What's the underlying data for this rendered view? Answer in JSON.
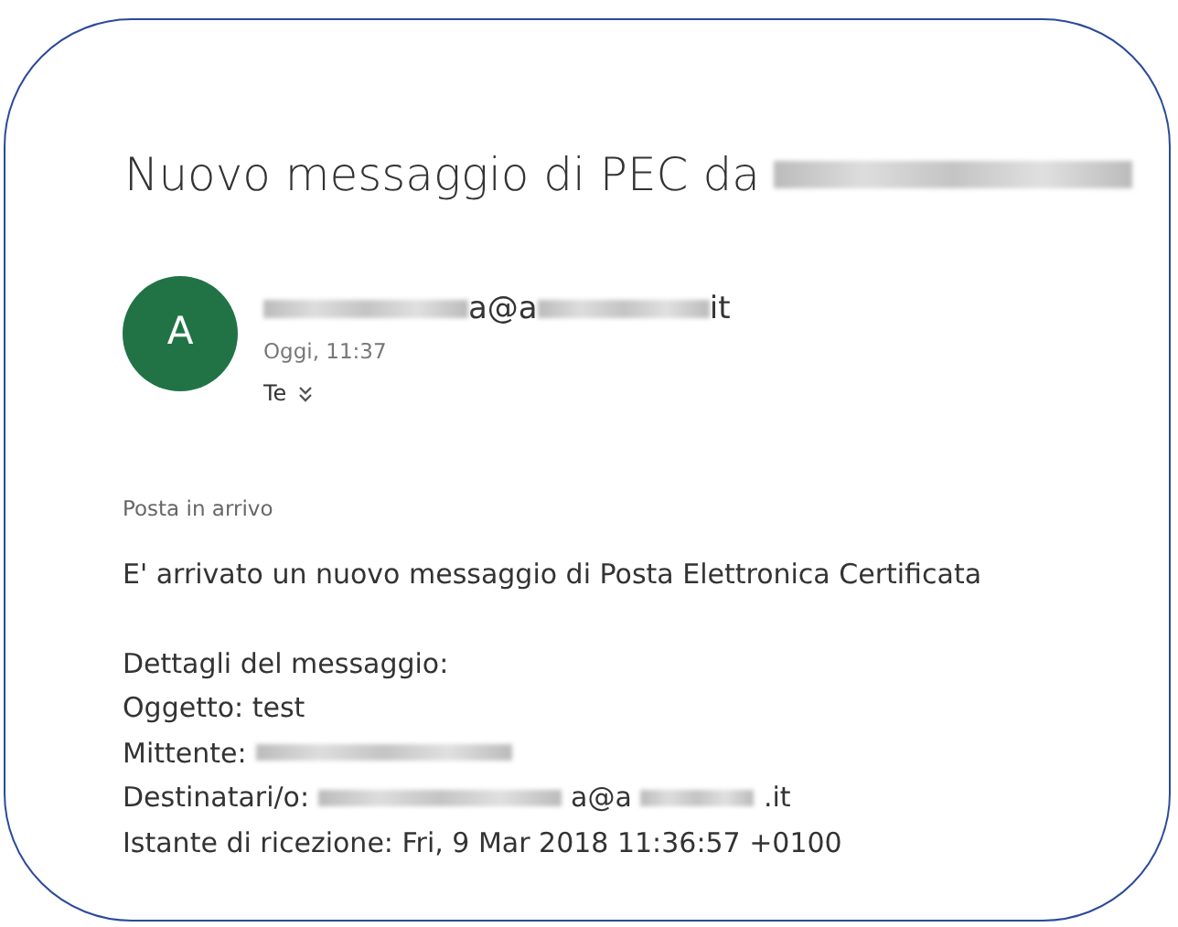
{
  "title": [
    {
      "kind": "text",
      "text": "Nuovo messaggio di PEC da"
    },
    {
      "kind": "redacted"
    }
  ],
  "sender": {
    "avatar": "A",
    "address": [
      {
        "kind": "redacted"
      },
      {
        "kind": "text",
        "text": "a@a"
      },
      {
        "kind": "redacted"
      },
      {
        "kind": "text",
        "text": "it"
      }
    ],
    "time": "Oggi, 11:37",
    "to": "Te"
  },
  "folder": "Posta in arrivo",
  "body": [
    {
      "kind": "line",
      "parts": [
        {
          "kind": "text",
          "text": "E' arrivato un nuovo messaggio di Posta Elettronica Certificata"
        }
      ]
    },
    {
      "kind": "gap"
    },
    {
      "kind": "line",
      "parts": [
        {
          "kind": "text",
          "text": "Dettagli del messaggio:"
        }
      ]
    },
    {
      "kind": "line",
      "parts": [
        {
          "kind": "text",
          "text": "Oggetto: test"
        }
      ]
    },
    {
      "kind": "line",
      "parts": [
        {
          "kind": "text",
          "text": "Mittente:"
        },
        {
          "kind": "redacted"
        }
      ]
    },
    {
      "kind": "line",
      "parts": [
        {
          "kind": "text",
          "text": "Destinatari/o:"
        },
        {
          "kind": "redacted"
        },
        {
          "kind": "text",
          "text": "a@a"
        },
        {
          "kind": "redacted"
        },
        {
          "kind": "text",
          "text": ".it"
        }
      ]
    },
    {
      "kind": "line",
      "parts": [
        {
          "kind": "text",
          "text": "Istante di ricezione: Fri, 9 Mar 2018 11:36:57 +0100"
        }
      ]
    }
  ]
}
